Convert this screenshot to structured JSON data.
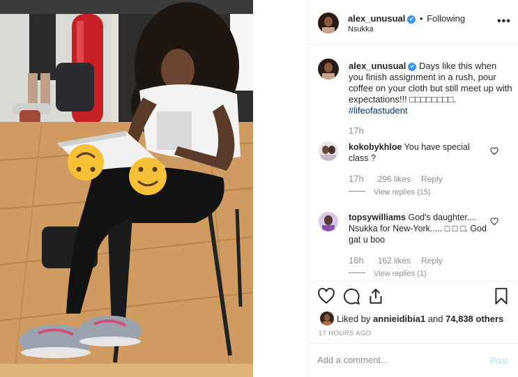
{
  "post": {
    "author": "alex_unusual",
    "verified_icon": "✔",
    "separator": "•",
    "follow_status": "Following",
    "location": "Nsukka",
    "more_icon": "•••",
    "caption": {
      "username": "alex_unusual",
      "text": "Days like this when you finish assignment in a rush, pour coffee on your cloth but still meet up with expectations!!! □□□□□□□□. ",
      "hashtag": "#lifeofastudent",
      "time": "17h"
    }
  },
  "comments": [
    {
      "username": "kokobykhloe",
      "text": "You have special class ?",
      "time": "17h",
      "likes": "296 likes",
      "reply": "Reply",
      "view_replies": "View replies (15)"
    },
    {
      "username": "topsywilliams",
      "text": "God's daughter.... Nsukka for New-York..... □ □ □. God gat u boo",
      "time": "16h",
      "likes": "162 likes",
      "reply": "Reply",
      "view_replies": "View replies (1)"
    }
  ],
  "actions": {
    "liked_prefix": "Liked by",
    "liked_user": "annieidibia1",
    "liked_and": "and",
    "liked_others": "74,838 others",
    "timestamp": "17 HOURS AGO"
  },
  "add_comment": {
    "placeholder": "Add a comment...",
    "post_label": "Post"
  },
  "icons": {
    "heart": "heart-icon",
    "comment": "comment-icon",
    "share": "share-icon",
    "save": "bookmark-icon"
  },
  "colors": {
    "verified": "#3897f0",
    "hashtag": "#003569",
    "muted": "#8e8e8e",
    "post_disabled": "#b2dffc"
  }
}
